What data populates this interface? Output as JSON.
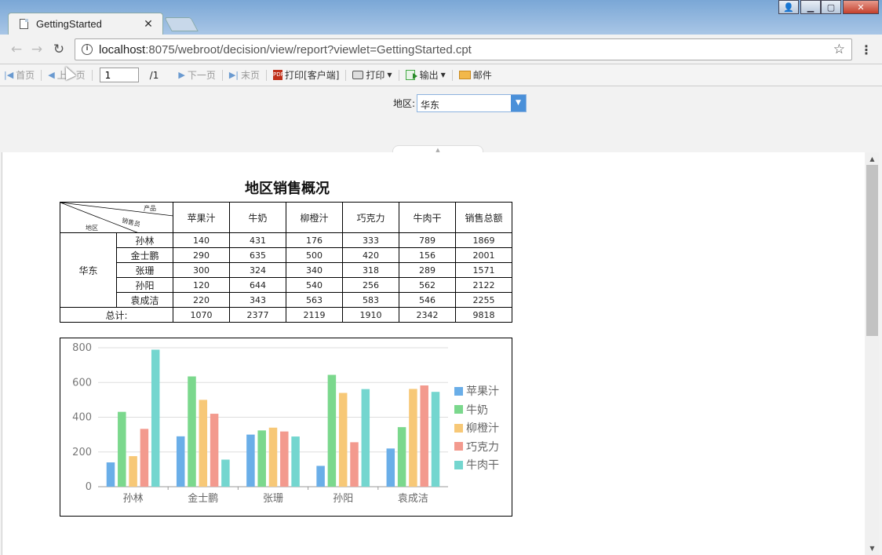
{
  "browser": {
    "tab_title": "GettingStarted",
    "tab_close": "✕",
    "address_host": "localhost",
    "address_rest": ":8075/webroot/decision/view/report?viewlet=GettingStarted.cpt"
  },
  "toolbar": {
    "first": "首页",
    "prev": "上一页",
    "page_current": "1",
    "page_total": "/1",
    "next": "下一页",
    "last": "末页",
    "print_client": "打印[客户端]",
    "print": "打印",
    "export": "输出",
    "mail": "邮件"
  },
  "params": {
    "region_label": "地区:",
    "region_value": "华东"
  },
  "report": {
    "title": "地区销售概况",
    "diag_product": "产品",
    "diag_sales": "销售员",
    "diag_region": "地区",
    "total_label": "总计:",
    "total_col": "销售总额",
    "region": "华东",
    "products": [
      "苹果汁",
      "牛奶",
      "柳橙汁",
      "巧克力",
      "牛肉干"
    ],
    "rows": [
      {
        "name": "孙林",
        "values": [
          "140",
          "431",
          "176",
          "333",
          "789"
        ],
        "total": "1869"
      },
      {
        "name": "金士鹏",
        "values": [
          "290",
          "635",
          "500",
          "420",
          "156"
        ],
        "total": "2001"
      },
      {
        "name": "张珊",
        "values": [
          "300",
          "324",
          "340",
          "318",
          "289"
        ],
        "total": "1571"
      },
      {
        "name": "孙阳",
        "values": [
          "120",
          "644",
          "540",
          "256",
          "562"
        ],
        "total": "2122"
      },
      {
        "name": "袁成洁",
        "values": [
          "220",
          "343",
          "563",
          "583",
          "546"
        ],
        "total": "2255"
      }
    ],
    "totals": [
      "1070",
      "2377",
      "2119",
      "1910",
      "2342"
    ],
    "grand_total": "9818"
  },
  "chart_data": {
    "type": "bar",
    "categories": [
      "孙林",
      "金士鹏",
      "张珊",
      "孙阳",
      "袁成洁"
    ],
    "series": [
      {
        "name": "苹果汁",
        "values": [
          140,
          290,
          300,
          120,
          220
        ],
        "color": "#6aaee8"
      },
      {
        "name": "牛奶",
        "values": [
          431,
          635,
          324,
          644,
          343
        ],
        "color": "#7bd88d"
      },
      {
        "name": "柳橙汁",
        "values": [
          176,
          500,
          340,
          540,
          563
        ],
        "color": "#f7c877"
      },
      {
        "name": "巧克力",
        "values": [
          333,
          420,
          318,
          256,
          583
        ],
        "color": "#f39a8e"
      },
      {
        "name": "牛肉干",
        "values": [
          789,
          156,
          289,
          562,
          546
        ],
        "color": "#74d6cf"
      }
    ],
    "ylim": [
      0,
      800
    ],
    "yticks": [
      "0",
      "200",
      "400",
      "600",
      "800"
    ],
    "grid": true,
    "legend_position": "right"
  }
}
